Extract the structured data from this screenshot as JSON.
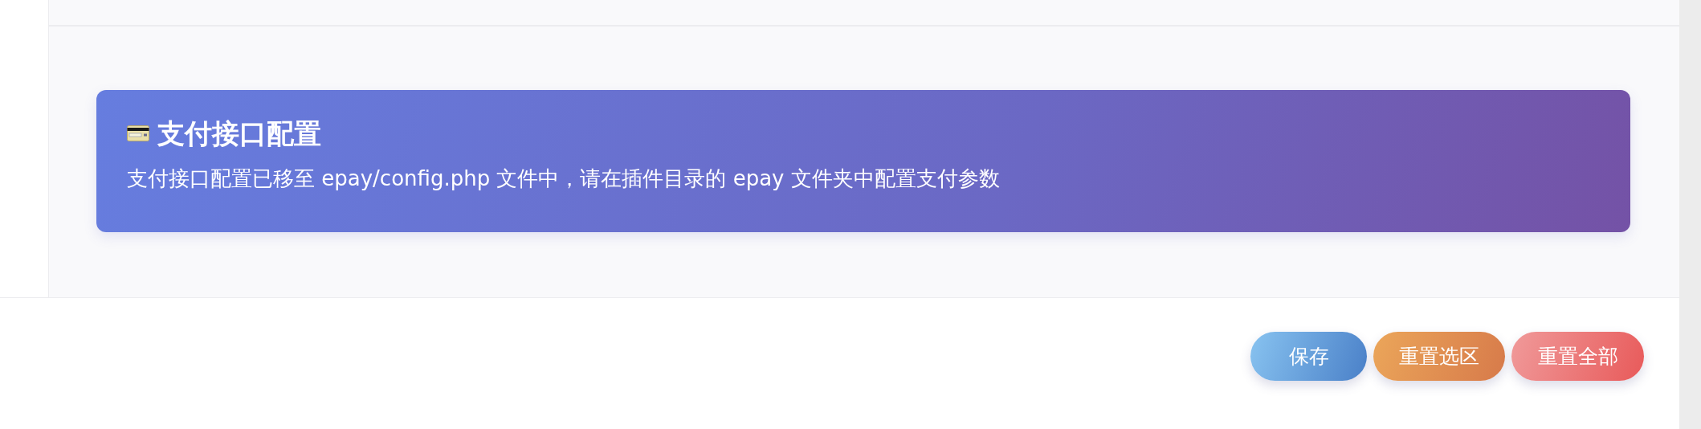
{
  "notice": {
    "title": "支付接口配置",
    "description": "支付接口配置已移至 epay/config.php 文件中，请在插件目录的 epay 文件夹中配置支付参数"
  },
  "buttons": [
    {
      "label": "保存",
      "kind": "primary"
    },
    {
      "label": "重置选区",
      "kind": "warning"
    },
    {
      "label": "重置全部",
      "kind": "danger"
    }
  ]
}
